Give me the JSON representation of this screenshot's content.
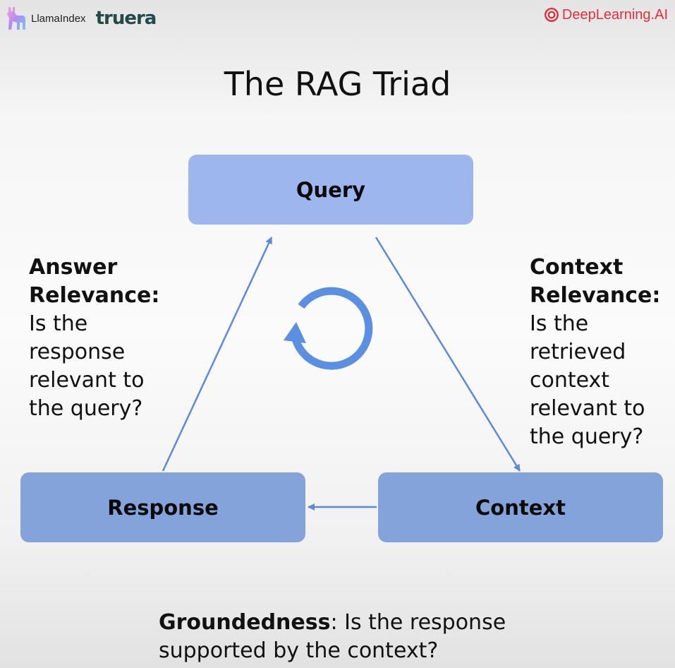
{
  "logos": {
    "llamaindex": "LlamaIndex",
    "truera": "truera",
    "deeplearning": "DeepLearning.AI"
  },
  "title": "The RAG Triad",
  "nodes": {
    "query": "Query",
    "response": "Response",
    "context": "Context"
  },
  "answer_relevance": {
    "heading_line1": "Answer",
    "heading_line2": "Relevance:",
    "lines": [
      "Is the",
      "response",
      "relevant to",
      "the query?"
    ]
  },
  "context_relevance": {
    "heading_line1": "Context",
    "heading_line2": "Relevance:",
    "lines": [
      "Is the",
      "retrieved",
      "context",
      "relevant to",
      "the query?"
    ]
  },
  "groundedness": {
    "label": "Groundedness",
    "line1_rest": ": Is the response",
    "line2": "supported by the context?"
  },
  "colors": {
    "query_box": "#9db7ee",
    "node_box": "#85a3db",
    "arrow": "#5b8ad6",
    "cycle": "#5a8fe2",
    "deeplearning_red": "#e0303b",
    "truera_green": "#214a49"
  }
}
